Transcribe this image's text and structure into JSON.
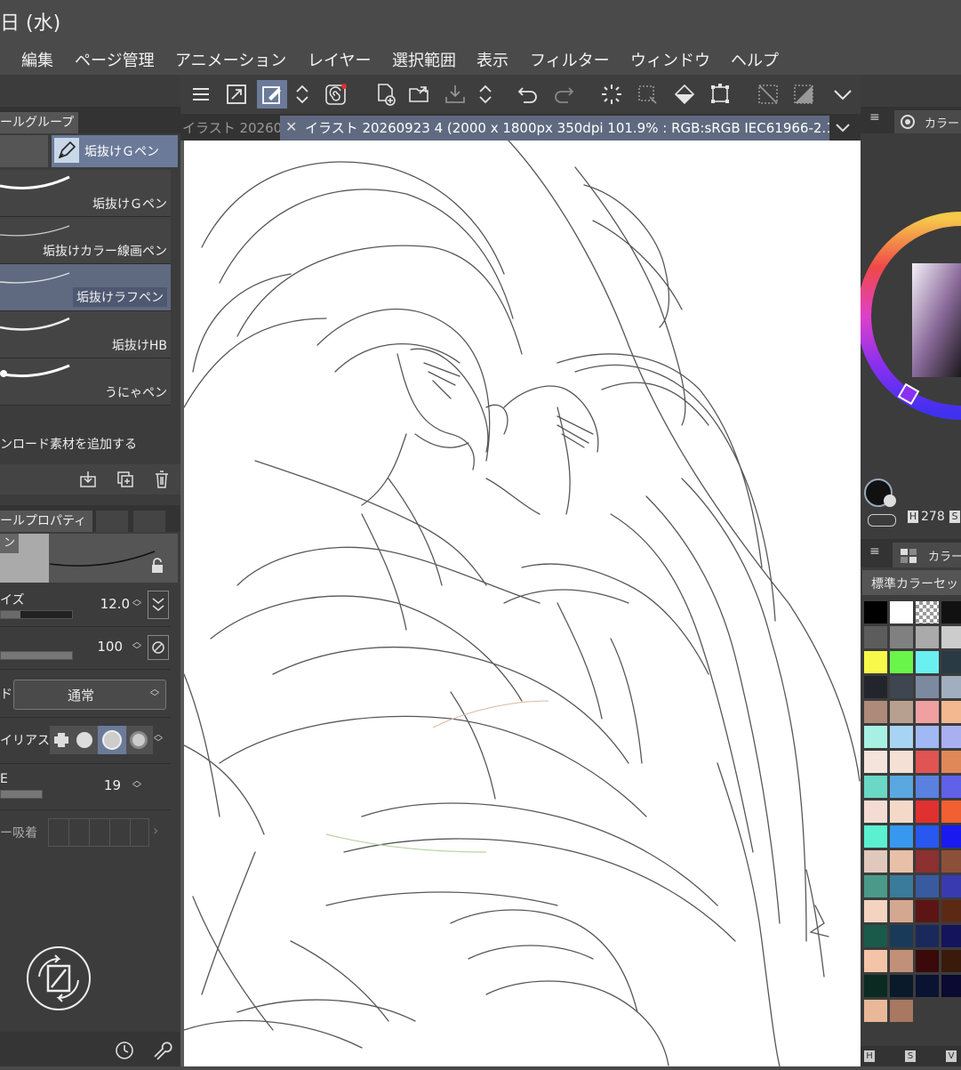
{
  "window": {
    "title_fragment": "日 (水)"
  },
  "menu": [
    "編集",
    "ページ管理",
    "アニメーション",
    "レイヤー",
    "選択範囲",
    "表示",
    "フィルター",
    "ウィンドウ",
    "ヘルプ"
  ],
  "left_panel": {
    "tool_group_tab": "ールグループ",
    "active_subtool": "垢抜けＧペン",
    "brushes": [
      {
        "name": "垢抜けＧペン"
      },
      {
        "name": "垢抜けカラー線画ペン"
      },
      {
        "name": "垢抜けラフペン",
        "selected": true
      },
      {
        "name": "垢抜けHB"
      },
      {
        "name": "うにゃペン"
      }
    ],
    "add_material": "ンロード素材を追加する",
    "properties_tab": "ールプロパティ",
    "preview_label": "ン",
    "props": {
      "size_label": "イズ",
      "size_value": "12.0",
      "opacity_value": "100",
      "blend_label": "ド",
      "blend_value": "通常",
      "aa_label": "イリアス",
      "stab_label": "E",
      "stab_value": "19",
      "snap_label": "ー吸着"
    }
  },
  "doc_tabs": {
    "inactive": "イラスト 20260",
    "active": "イラスト 20260923 4 (2000 x 1800px 350dpi 101.9% : RGB:sRGB IEC61966-2.1)"
  },
  "right_panel": {
    "color_tab": "カラー",
    "hsv_h_label": "H",
    "hsv_h_value": "278",
    "hsv_s_label": "S",
    "color_set_tab": "カラー",
    "color_set_name": "標準カラーセッ",
    "footer": [
      "H",
      "S",
      "V"
    ],
    "swatches": [
      "#000000",
      "#ffffff",
      "checker",
      "#111111",
      "#5c5c5c",
      "#808080",
      "#aaaaaa",
      "#cccccc",
      "#f8f84a",
      "#6af54a",
      "#6af0f0",
      "#2a3a44",
      "#22262c",
      "#3e4650",
      "#7c8aa0",
      "#a0aec0",
      "#ad8a7a",
      "#b8a090",
      "#f0a0a0",
      "#f4b890",
      "#a8f0e4",
      "#a8d4f4",
      "#a0b8f4",
      "#a8b0f0",
      "#f4e4dc",
      "#f4e0d4",
      "#e05454",
      "#e08858",
      "#6ad8c4",
      "#5aa8e0",
      "#5a80e0",
      "#6060e8",
      "#f4dcd4",
      "#f4d8c8",
      "#e03030",
      "#f06030",
      "#5af0d0",
      "#3898f0",
      "#2858f0",
      "#1a1af0",
      "#e0c8bc",
      "#e8c0a8",
      "#8c3030",
      "#8c5038",
      "#4a9a8a",
      "#3a7a9a",
      "#3a5aa0",
      "#3a3ab0",
      "#f4d4c0",
      "#d4a890",
      "#5c1414",
      "#5c2a14",
      "#1a5a4a",
      "#1a3a5a",
      "#1a285c",
      "#14145c",
      "#f4c4a8",
      "#c09078",
      "#3a0a0a",
      "#3a1a0a",
      "#0a2a22",
      "#0a1a2a",
      "#0a1432",
      "#0a0a32",
      "#e8b898",
      "#a87860"
    ]
  },
  "colors": {
    "accent": "#6b7a99",
    "panel": "#3c3c3c",
    "canvas": "#ffffff"
  }
}
